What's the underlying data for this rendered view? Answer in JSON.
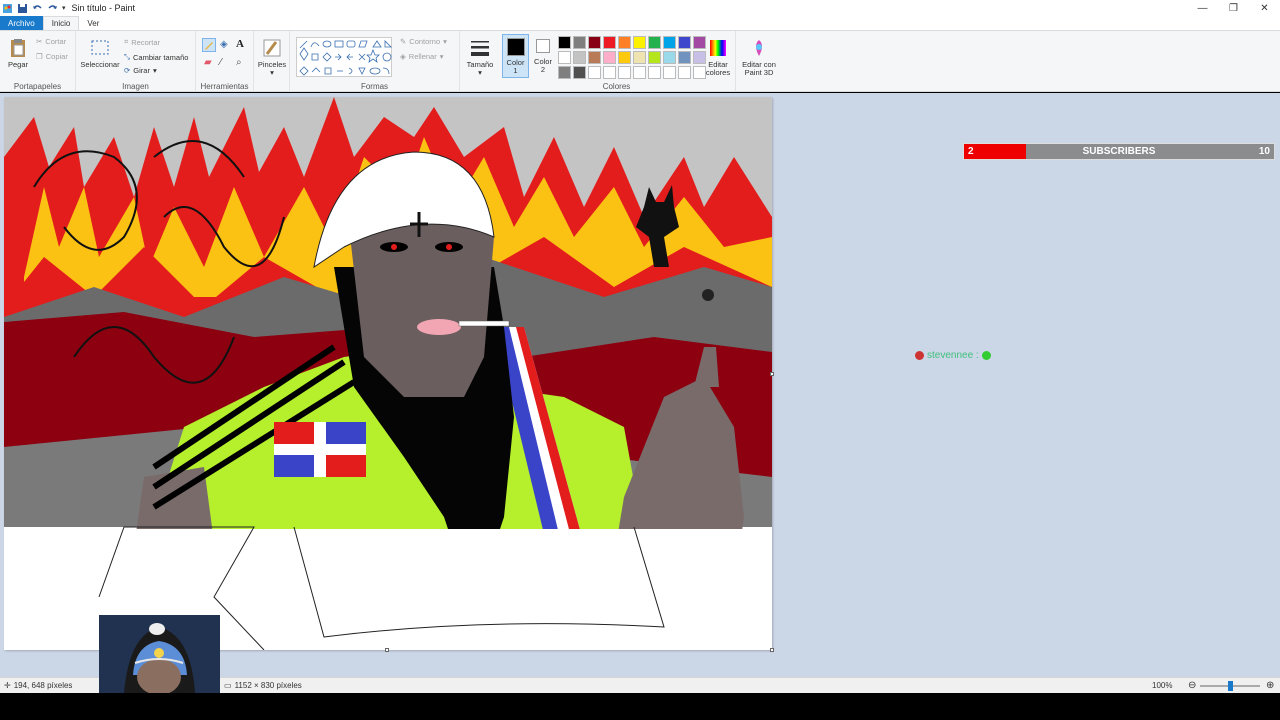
{
  "window": {
    "title": "Sin título - Paint",
    "controls": {
      "minimize": "—",
      "restore": "❐",
      "close": "✕"
    }
  },
  "menu": {
    "file": "Archivo",
    "home": "Inicio",
    "view": "Ver"
  },
  "ribbon": {
    "clipboard": {
      "label": "Portapapeles",
      "paste": "Pegar",
      "cut": "Cortar",
      "copy": "Copiar"
    },
    "image": {
      "label": "Imagen",
      "select": "Seleccionar",
      "crop": "Recortar",
      "resize": "Cambiar tamaño",
      "rotate": "Girar"
    },
    "tools": {
      "label": "Herramientas"
    },
    "brushes": {
      "label": "Pinceles"
    },
    "shapes": {
      "label": "Formas",
      "outline": "Contorno",
      "fill": "Rellenar"
    },
    "size": {
      "label": "Tamaño"
    },
    "color1": {
      "label_a": "Color",
      "label_b": "1"
    },
    "color2": {
      "label_a": "Color",
      "label_b": "2"
    },
    "colors": {
      "label": "Colores"
    },
    "edit_colors": {
      "label_a": "Editar",
      "label_b": "colores"
    },
    "edit_3d": {
      "label_a": "Editar con",
      "label_b": "Paint 3D"
    },
    "palette": [
      "#000000",
      "#7f7f7f",
      "#880015",
      "#ed1c24",
      "#ff7f27",
      "#fff200",
      "#22b14c",
      "#00a2e8",
      "#3f48cc",
      "#a349a4",
      "#ffffff",
      "#c3c3c3",
      "#b97a57",
      "#ffaec9",
      "#ffc90e",
      "#efe4b0",
      "#b5e61d",
      "#99d9ea",
      "#7092be",
      "#c8bfe7",
      "#7f7f7f",
      "#505050",
      "#ffffff",
      "#ffffff",
      "#ffffff",
      "#ffffff",
      "#ffffff",
      "#ffffff",
      "#ffffff",
      "#ffffff"
    ]
  },
  "overlay": {
    "subscribers": {
      "current": "2",
      "label": "SUBSCRIBERS",
      "goal": "10",
      "progress_fraction": 0.2
    },
    "chat": {
      "user": "stevennee :"
    }
  },
  "status": {
    "cursor_pos": "194, 648 píxeles",
    "image_size": "1152 × 830 píxeles",
    "zoom": "100%"
  },
  "colors": {
    "accent": "#1979ca",
    "workspace": "#cbd6e6",
    "sub_red": "#ee0000"
  }
}
